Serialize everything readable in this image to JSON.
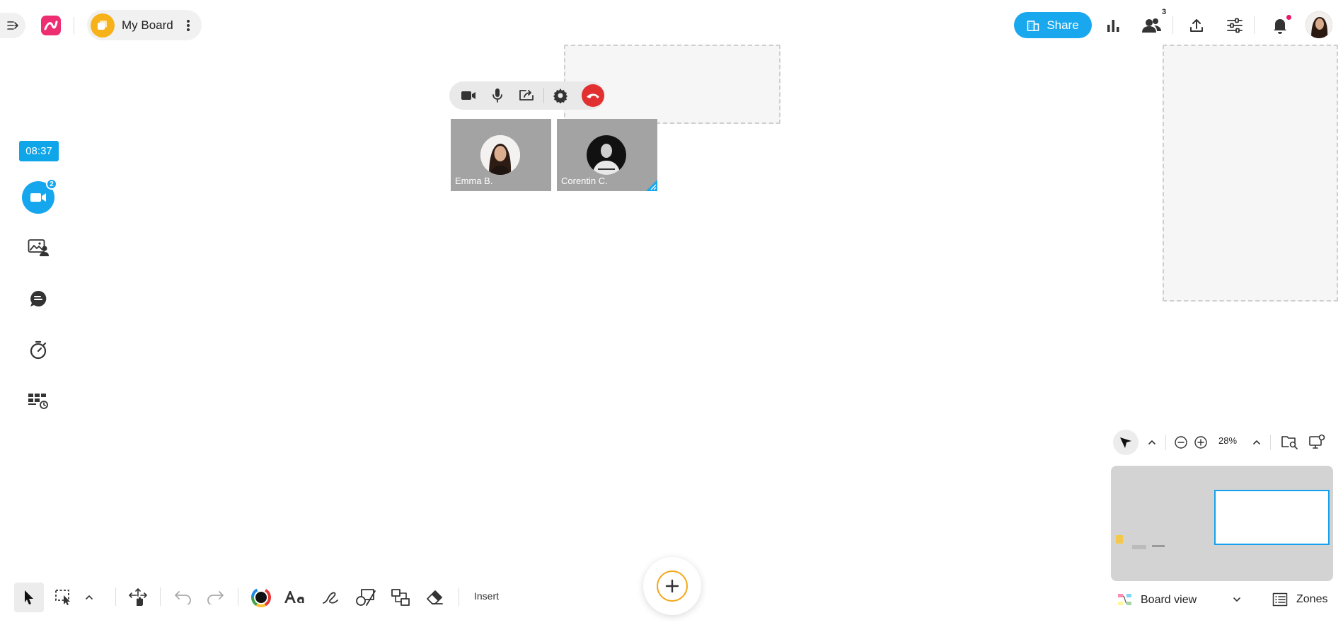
{
  "header": {
    "board_title": "My Board",
    "share_label": "Share",
    "collaborators_count": "3"
  },
  "left_rail": {
    "timer": "08:37",
    "video_badge": "2",
    "items": [
      "video-call",
      "image-presenter",
      "chat",
      "timer",
      "templates"
    ]
  },
  "call": {
    "controls": [
      "camera",
      "microphone",
      "screen-share",
      "settings",
      "hang-up"
    ],
    "participants": [
      {
        "name": "Emma B."
      },
      {
        "name": "Corentin C."
      }
    ]
  },
  "bottom_toolbar": {
    "tools": [
      "select",
      "area-select",
      "expand",
      "pan",
      "undo",
      "redo",
      "color",
      "text",
      "pen",
      "shapes",
      "connector",
      "eraser"
    ],
    "insert_label": "Insert"
  },
  "navigator": {
    "zoom": "28%",
    "view_label": "Board view",
    "zones_label": "Zones"
  },
  "colors": {
    "accent": "#19a8ee",
    "brand": "#ee2e73",
    "board_icon": "#f7b21b",
    "hangup": "#e23030"
  }
}
